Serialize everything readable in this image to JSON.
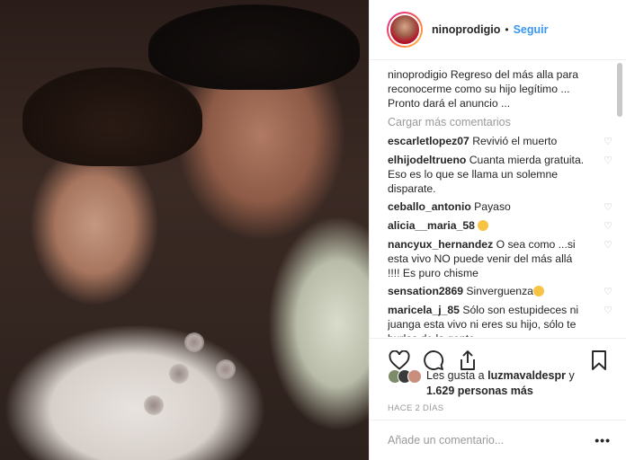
{
  "header": {
    "username": "ninoprodigio",
    "separator": "•",
    "follow_label": "Seguir"
  },
  "caption": {
    "username": "ninoprodigio",
    "text": "Regreso del más alla para reconocerme como su hijo legítimo ... Pronto dará el anuncio ..."
  },
  "load_more_label": "Cargar más comentarios",
  "comments": [
    {
      "username": "escarletlopez07",
      "text": "Revivió el muerto"
    },
    {
      "username": "elhijodeltrueno",
      "text": "Cuanta mierda gratuita. Eso es lo que se llama un solemne disparate."
    },
    {
      "username": "ceballo_antonio",
      "text": "Payaso"
    },
    {
      "username": "alicia__maria_58",
      "text": ""
    },
    {
      "username": "nancyux_hernandez",
      "text": "O sea como ...si esta vivo NO puede venir del más allá !!!! Es puro chisme"
    },
    {
      "username": "sensation2869",
      "text": "Sinverguenza"
    },
    {
      "username": "maricela_j_85",
      "text": "Sólo son estupideces ni juanga esta vivo ni eres su hijo, sólo te burlas de la gente..."
    }
  ],
  "icons": {
    "heart": "heart-icon",
    "comment": "comment-icon",
    "share": "share-icon",
    "bookmark": "bookmark-icon"
  },
  "likes": {
    "prefix": "Les gusta a",
    "user": "luzmavaldespr",
    "joiner": "y",
    "count": "1.629 personas más"
  },
  "time_ago": "HACE 2 DÍAS",
  "add_comment": {
    "placeholder": "Añade un comentario...",
    "more_label": "•••"
  }
}
